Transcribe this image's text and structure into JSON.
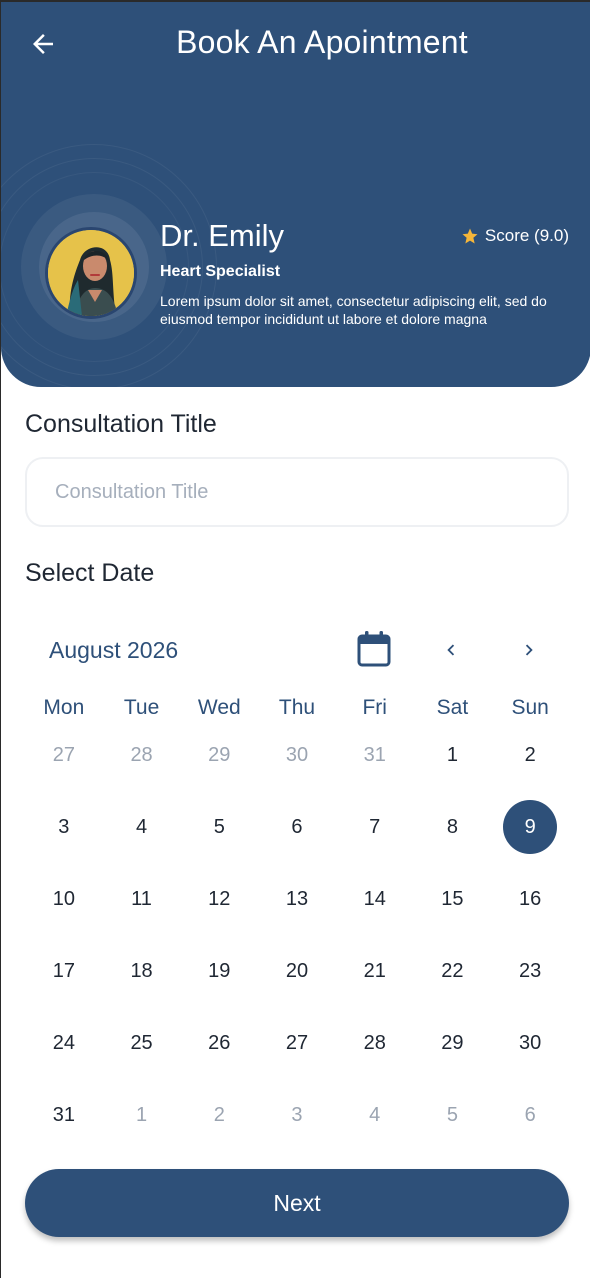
{
  "header": {
    "title": "Book An Apointment",
    "back_icon": "arrow-left-icon",
    "background_color": "#2e5079"
  },
  "doctor": {
    "name": "Dr. Emily",
    "specialty": "Heart Specialist",
    "description": "Lorem ipsum dolor sit amet, consectetur adipiscing elit, sed do eiusmod tempor incididunt ut labore et dolore magna",
    "score_label": "Score (9.0)",
    "score_icon": "star-icon",
    "star_color": "#f5b63a"
  },
  "form": {
    "title_label": "Consultation Title",
    "title_placeholder": "Consultation Title",
    "title_value": "",
    "date_label": "Select Date"
  },
  "calendar": {
    "month_label": "August 2026",
    "calendar_icon": "calendar-icon",
    "prev_icon": "chevron-left-icon",
    "next_icon": "chevron-right-icon",
    "weekdays": [
      "Mon",
      "Tue",
      "Wed",
      "Thu",
      "Fri",
      "Sat",
      "Sun"
    ],
    "selected_day": "9",
    "days": [
      {
        "label": "27",
        "muted": true
      },
      {
        "label": "28",
        "muted": true
      },
      {
        "label": "29",
        "muted": true
      },
      {
        "label": "30",
        "muted": true
      },
      {
        "label": "31",
        "muted": true
      },
      {
        "label": "1",
        "muted": false
      },
      {
        "label": "2",
        "muted": false
      },
      {
        "label": "3",
        "muted": false
      },
      {
        "label": "4",
        "muted": false
      },
      {
        "label": "5",
        "muted": false
      },
      {
        "label": "6",
        "muted": false
      },
      {
        "label": "7",
        "muted": false
      },
      {
        "label": "8",
        "muted": false
      },
      {
        "label": "9",
        "muted": false
      },
      {
        "label": "10",
        "muted": false
      },
      {
        "label": "11",
        "muted": false
      },
      {
        "label": "12",
        "muted": false
      },
      {
        "label": "13",
        "muted": false
      },
      {
        "label": "14",
        "muted": false
      },
      {
        "label": "15",
        "muted": false
      },
      {
        "label": "16",
        "muted": false
      },
      {
        "label": "17",
        "muted": false
      },
      {
        "label": "18",
        "muted": false
      },
      {
        "label": "19",
        "muted": false
      },
      {
        "label": "20",
        "muted": false
      },
      {
        "label": "21",
        "muted": false
      },
      {
        "label": "22",
        "muted": false
      },
      {
        "label": "23",
        "muted": false
      },
      {
        "label": "24",
        "muted": false
      },
      {
        "label": "25",
        "muted": false
      },
      {
        "label": "26",
        "muted": false
      },
      {
        "label": "27",
        "muted": false
      },
      {
        "label": "28",
        "muted": false
      },
      {
        "label": "29",
        "muted": false
      },
      {
        "label": "30",
        "muted": false
      },
      {
        "label": "31",
        "muted": false
      },
      {
        "label": "1",
        "muted": true
      },
      {
        "label": "2",
        "muted": true
      },
      {
        "label": "3",
        "muted": true
      },
      {
        "label": "4",
        "muted": true
      },
      {
        "label": "5",
        "muted": true
      },
      {
        "label": "6",
        "muted": true
      }
    ]
  },
  "actions": {
    "next_label": "Next"
  }
}
